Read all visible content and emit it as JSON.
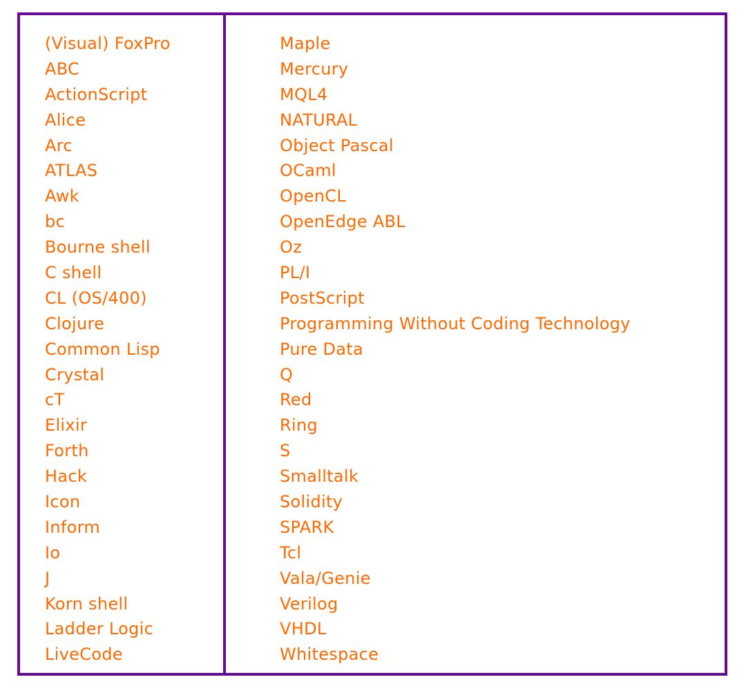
{
  "colors": {
    "border": "#66099c",
    "text": "#ff6a00"
  },
  "left_column": [
    "(Visual) FoxPro",
    "ABC",
    "ActionScript",
    "Alice",
    "Arc",
    "ATLAS",
    "Awk",
    "bc",
    "Bourne shell",
    "C shell",
    "CL (OS/400)",
    "Clojure",
    "Common Lisp",
    "Crystal",
    "cT",
    "Elixir",
    "Forth",
    "Hack",
    "Icon",
    "Inform",
    "Io",
    "J",
    "Korn shell",
    "Ladder Logic",
    "LiveCode"
  ],
  "right_column": [
    "Maple",
    "Mercury",
    "MQL4",
    "NATURAL",
    "Object Pascal",
    "OCaml",
    "OpenCL",
    "OpenEdge ABL",
    "Oz",
    "PL/I",
    "PostScript",
    "Programming Without Coding Technology",
    "Pure Data",
    "Q",
    "Red",
    "Ring",
    "S",
    "Smalltalk",
    "Solidity",
    "SPARK",
    "Tcl",
    "Vala/Genie",
    "Verilog",
    "VHDL",
    "Whitespace"
  ]
}
